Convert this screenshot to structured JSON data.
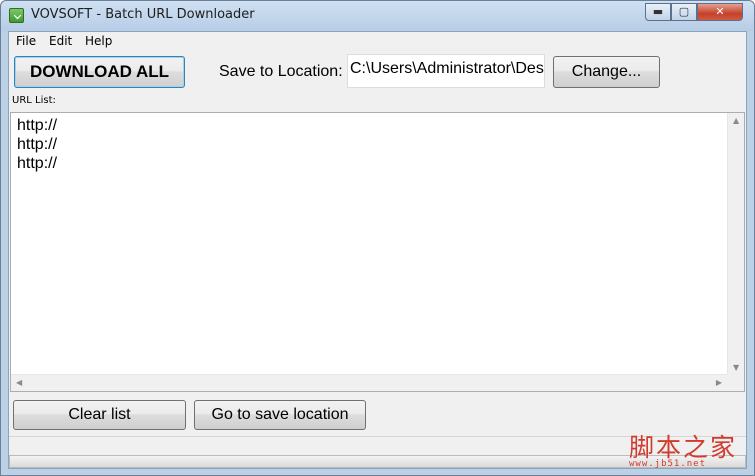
{
  "window": {
    "title": "VOVSOFT - Batch URL Downloader",
    "controls": {
      "minimize": "▬",
      "maximize": "▢",
      "close": "✕"
    }
  },
  "menu": {
    "items": [
      {
        "label": "File"
      },
      {
        "label": "Edit"
      },
      {
        "label": "Help"
      }
    ]
  },
  "toolbar": {
    "download_all_label": "DOWNLOAD ALL",
    "save_to_location_label": "Save to Location:",
    "save_path_value": "C:\\Users\\Administrator\\Desktop",
    "change_label": "Change..."
  },
  "url_list": {
    "label": "URL List:",
    "lines": [
      "http://",
      "http://",
      "http://"
    ]
  },
  "actions": {
    "clear_list_label": "Clear list",
    "go_to_save_location_label": "Go to save location"
  },
  "progress": {
    "value": 0
  },
  "watermark": {
    "text": "脚本之家",
    "url": "www.jb51.net"
  },
  "colors": {
    "title_bar": "#bcd0e6",
    "client_bg": "#f0f0f0",
    "close_button": "#c4412b",
    "watermark": "#d23b2b"
  }
}
